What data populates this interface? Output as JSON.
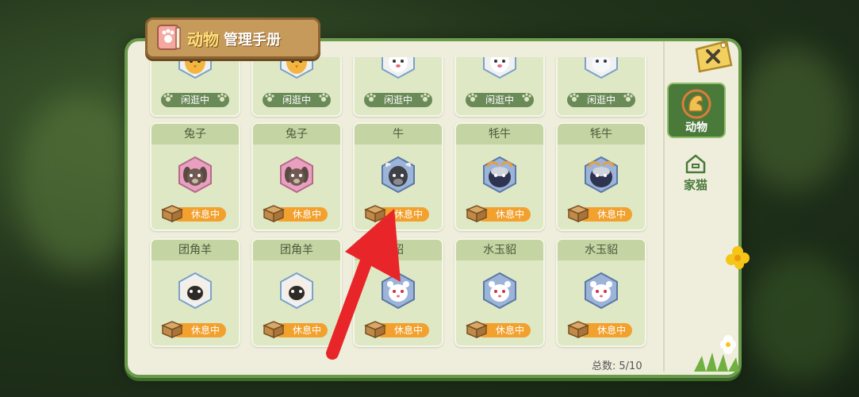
{
  "window": {
    "title_icon": "book-paw-icon",
    "title_part1": "动物",
    "title_part2": "管理手册"
  },
  "close": {
    "icon": "close-icon"
  },
  "tabs": [
    {
      "label": "动物",
      "icon": "squirrel-icon",
      "selected": true
    },
    {
      "label": "家猫",
      "icon": "house-icon",
      "selected": false
    }
  ],
  "rows": [
    {
      "cards": [
        {
          "name": "",
          "status": "闲逛中",
          "status_type": "idle",
          "animal": "rooster"
        },
        {
          "name": "",
          "status": "闲逛中",
          "status_type": "idle",
          "animal": "rooster"
        },
        {
          "name": "",
          "status": "闲逛中",
          "status_type": "idle",
          "animal": "goat"
        },
        {
          "name": "",
          "status": "闲逛中",
          "status_type": "idle",
          "animal": "panda-goat"
        },
        {
          "name": "",
          "status": "闲逛中",
          "status_type": "idle",
          "animal": "arctic-fox"
        }
      ]
    },
    {
      "cards": [
        {
          "name": "兔子",
          "status": "休息中",
          "status_type": "rest",
          "animal": "rabbit"
        },
        {
          "name": "兔子",
          "status": "休息中",
          "status_type": "rest",
          "animal": "rabbit"
        },
        {
          "name": "牛",
          "status": "休息中",
          "status_type": "rest",
          "animal": "cow"
        },
        {
          "name": "牦牛",
          "status": "休息中",
          "status_type": "rest",
          "animal": "yak"
        },
        {
          "name": "牦牛",
          "status": "休息中",
          "status_type": "rest",
          "animal": "yak"
        }
      ]
    },
    {
      "cards": [
        {
          "name": "团角羊",
          "status": "休息中",
          "status_type": "rest",
          "animal": "sheep"
        },
        {
          "name": "团角羊",
          "status": "休息中",
          "status_type": "rest",
          "animal": "sheep"
        },
        {
          "name": "貂",
          "status": "休息中",
          "status_type": "rest",
          "animal": "ermine"
        },
        {
          "name": "水玉貂",
          "status": "休息中",
          "status_type": "rest",
          "animal": "ermine"
        },
        {
          "name": "水玉貂",
          "status": "休息中",
          "status_type": "rest",
          "animal": "ermine"
        }
      ]
    }
  ],
  "total": {
    "label": "总数:",
    "value": "5/10"
  },
  "colors": {
    "panel_border": "#6a9a4c",
    "status_rest": "#f2a12e",
    "status_idle": "#6a8a58",
    "arrow": "#e8262a"
  }
}
